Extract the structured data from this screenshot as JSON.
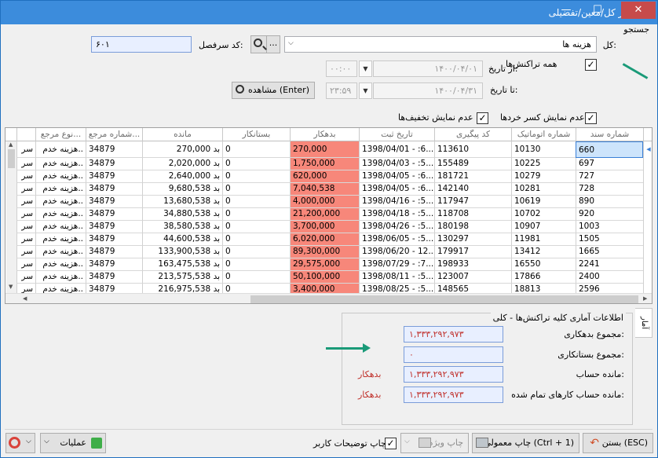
{
  "window": {
    "title": "دفتر کل/معین/تفضیلی",
    "min_symbol": "—",
    "max_symbol": "☐",
    "close_symbol": "✕"
  },
  "search": {
    "section_label": "جستجو",
    "kol_label": "کل:",
    "kol_value": "هزینه ها",
    "code_label": "کد سرفصل:",
    "code_value": "۶۰۱",
    "dots_label": "...",
    "all_transactions_label": "همه تراکنش‌ها",
    "from_date_label": "از تاریخ:",
    "from_date_value": "۱۴۰۰/۰۴/۰۱",
    "from_time_value": "۰۰:۰۰",
    "to_date_label": "تا تاریخ:",
    "to_date_value": "۱۴۰۰/۰۴/۳۱",
    "to_time_value": "۲۳:۵۹",
    "view_button_label": "مشاهده (Enter)",
    "no_fraction_label": "عدم نمایش کسر خردها",
    "no_discount_label": "عدم نمایش تخفیف‌ها",
    "check_mark": "✓"
  },
  "grid": {
    "columns": [
      "شماره سند",
      "شماره اتوماتیک",
      "کد پیگیری",
      "تاریخ ثبت",
      "بدهکار",
      "بستانکار",
      "مانده",
      "شماره مرجع...",
      "نوع مرجع..."
    ],
    "rows": [
      {
        "sanad": "660",
        "auto": "10130",
        "code": "113610",
        "date": "1398/04/01 - :6...",
        "bed": "270,000",
        "bes": "0",
        "mandeh": "270,000 بد",
        "ref": "34879",
        "type": "هزینه خدم..",
        "extra": "سر"
      },
      {
        "sanad": "697",
        "auto": "10225",
        "code": "155489",
        "date": "1398/04/03 - :5...",
        "bed": "1,750,000",
        "bes": "0",
        "mandeh": "2,020,000 بد",
        "ref": "34879",
        "type": "هزینه خدم..",
        "extra": "سر"
      },
      {
        "sanad": "727",
        "auto": "10279",
        "code": "181721",
        "date": "1398/04/05 - :6...",
        "bed": "620,000",
        "bes": "0",
        "mandeh": "2,640,000 بد",
        "ref": "34879",
        "type": "هزینه خدم..",
        "extra": "سر"
      },
      {
        "sanad": "728",
        "auto": "10281",
        "code": "142140",
        "date": "1398/04/05 - :6...",
        "bed": "7,040,538",
        "bes": "0",
        "mandeh": "9,680,538 بد",
        "ref": "34879",
        "type": "هزینه خدم..",
        "extra": "سر"
      },
      {
        "sanad": "890",
        "auto": "10619",
        "code": "117947",
        "date": "1398/04/16 - :5...",
        "bed": "4,000,000",
        "bes": "0",
        "mandeh": "13,680,538 بد",
        "ref": "34879",
        "type": "هزینه خدم..",
        "extra": "سر"
      },
      {
        "sanad": "920",
        "auto": "10702",
        "code": "118708",
        "date": "1398/04/18 - :5...",
        "bed": "21,200,000",
        "bes": "0",
        "mandeh": "34,880,538 بد",
        "ref": "34879",
        "type": "هزینه خدم..",
        "extra": "سر"
      },
      {
        "sanad": "1003",
        "auto": "10907",
        "code": "180198",
        "date": "1398/04/26 - :5...",
        "bed": "3,700,000",
        "bes": "0",
        "mandeh": "38,580,538 بد",
        "ref": "34879",
        "type": "هزینه خدم..",
        "extra": "سر"
      },
      {
        "sanad": "1505",
        "auto": "11981",
        "code": "130297",
        "date": "1398/06/05 - :5...",
        "bed": "6,020,000",
        "bes": "0",
        "mandeh": "44,600,538 بد",
        "ref": "34879",
        "type": "هزینه خدم..",
        "extra": "سر"
      },
      {
        "sanad": "1665",
        "auto": "13412",
        "code": "179917",
        "date": "1398/06/20 - 12...",
        "bed": "89,300,000",
        "bes": "0",
        "mandeh": "133,900,538 بد",
        "ref": "34879",
        "type": "هزینه خدم..",
        "extra": "سر"
      },
      {
        "sanad": "2241",
        "auto": "16550",
        "code": "198933",
        "date": "1398/07/29 - :7...",
        "bed": "29,575,000",
        "bes": "0",
        "mandeh": "163,475,538 بد",
        "ref": "34879",
        "type": "هزینه خدم..",
        "extra": "سر"
      },
      {
        "sanad": "2400",
        "auto": "17866",
        "code": "123007",
        "date": "1398/08/11 - :5...",
        "bed": "50,100,000",
        "bes": "0",
        "mandeh": "213,575,538 بد",
        "ref": "34879",
        "type": "هزینه خدم..",
        "extra": "سر"
      },
      {
        "sanad": "2596",
        "auto": "18813",
        "code": "148565",
        "date": "1398/08/25 - :5...",
        "bed": "3,400,000",
        "bes": "0",
        "mandeh": "216,975,538 بد",
        "ref": "34879",
        "type": "هزینه خدم..",
        "extra": "سر"
      }
    ]
  },
  "stats": {
    "title": "اطلاعات آماری کلیه تراکنش‌ها - کلی",
    "debit_label": "مجموع بدهکاری:",
    "debit_value": "۱,۳۳۳,۲۹۲,۹۷۳",
    "credit_label": "مجموع بستانکاری:",
    "credit_value": "۰",
    "balance_label": "مانده حساب:",
    "balance_value": "۱,۳۳۳,۲۹۲,۹۷۳",
    "balance_badge": "بدهکار",
    "completed_label": "مانده حساب کارهای تمام شده:",
    "completed_value": "۱,۳۳۳,۲۹۲,۹۷۳",
    "completed_badge": "بدهکار",
    "side_tab": "آمار"
  },
  "footer": {
    "close_button": "بستن (ESC)",
    "print_normal_button": "چاپ معمولی (Ctrl + 1)",
    "print_special_button": "چاپ ویژه",
    "print_desc_label": "چاپ توضیحات کاربر",
    "operations_button": "عملیات"
  },
  "colors": {
    "titlebar": "#3c8cdc",
    "debit_cell": "#f7877a",
    "annotation_arrow": "#1a9a78",
    "value_red": "#c0302a"
  }
}
